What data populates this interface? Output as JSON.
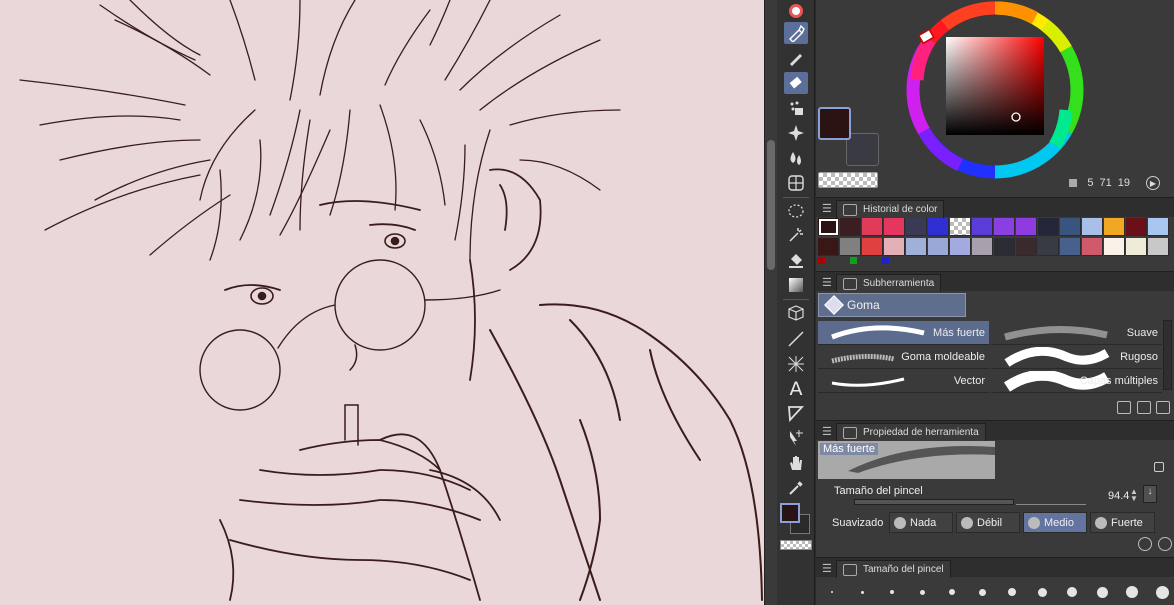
{
  "toolbar": {
    "tools": [
      "menu-icon",
      "pen-icon",
      "pencil-icon",
      "eraser-icon",
      "decoration-icon",
      "blend-icon",
      "fill-icon",
      "figure-grid-icon",
      "selection-icon",
      "auto-select-icon",
      "bucket-icon",
      "gradient-icon",
      "3d-cube-icon",
      "line-icon",
      "ruler-icon",
      "text-icon",
      "frame-icon",
      "operation-icon",
      "hand-icon",
      "eyedropper-icon"
    ]
  },
  "color": {
    "main": "#2b1313",
    "sub": "#3a3a42",
    "values": {
      "h": "5",
      "s": "71",
      "v": "19"
    },
    "accent": "#5b6f9a"
  },
  "history": {
    "tab_label": "Historial de color",
    "row1": [
      "#2b1313",
      "#3c1e22",
      "#e23b5a",
      "#e4365f",
      "#3a3a54",
      "#2f2fd4",
      "checker",
      "#5a3cd8",
      "#8a3fe0",
      "#8e3ce0",
      "#26263a",
      "#39557f",
      "#a8bfe9",
      "#f0a823",
      "#6b1018",
      "#a8c6f0"
    ],
    "row2": [
      "#3a1717",
      "#808080",
      "#e04040",
      "#e4b0b8",
      "#a0b0d8",
      "#9aa8d8",
      "#a2aae0",
      "#a8a0ac",
      "#2c2c34",
      "#3a2a2e",
      "#383a44",
      "#48608c",
      "#d05a6a",
      "#f8f2e8",
      "#f0ead8",
      "#c8c8c8"
    ],
    "dots": [
      "#b00000",
      "#10a020",
      "#2020d0"
    ]
  },
  "subtool": {
    "tab_label": "Subherramienta",
    "group": "Goma",
    "brushes": [
      {
        "label": "Más fuerte",
        "active": true
      },
      {
        "label": "Suave",
        "active": false
      },
      {
        "label": "Goma moldeable",
        "active": false
      },
      {
        "label": "Rugoso",
        "active": false
      },
      {
        "label": "Vector",
        "active": false
      },
      {
        "label": "Capas múltiples",
        "active": false
      }
    ]
  },
  "property": {
    "tab_label": "Propiedad de herramienta",
    "preview_label": "Más fuerte",
    "size_label": "Tamaño del pincel",
    "size_value": "94.4",
    "smoothing_label": "Suavizado",
    "smoothing_options": [
      "Nada",
      "Débil",
      "Medio",
      "Fuerte"
    ],
    "smoothing_selected": "Medio"
  },
  "brush_size": {
    "tab_label": "Tamaño del pincel"
  }
}
